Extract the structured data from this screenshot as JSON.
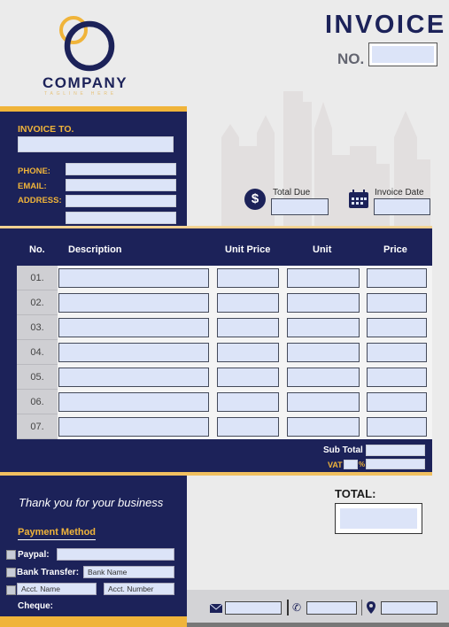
{
  "header": {
    "company_name": "COMPANY",
    "company_tagline": "TAGLINE HERE",
    "invoice_title": "INVOICE",
    "invoice_no_label": "NO.",
    "invoice_no_value": ""
  },
  "bill_to": {
    "title": "INVOICE TO.",
    "name_value": "",
    "fields": [
      {
        "label": "PHONE:",
        "value": ""
      },
      {
        "label": "EMAIL:",
        "value": ""
      },
      {
        "label": "ADDRESS:",
        "value": ""
      },
      {
        "label": "",
        "value": ""
      }
    ]
  },
  "summary": {
    "total_due_label": "Total Due",
    "total_due_value": "",
    "invoice_date_label": "Invoice Date",
    "invoice_date_value": "",
    "icons": {
      "total_due": "dollar-icon",
      "invoice_date": "calendar-icon"
    }
  },
  "table": {
    "columns": [
      "No.",
      "Description",
      "Unit Price",
      "Unit",
      "Price"
    ],
    "rows": [
      {
        "no": "01.",
        "description": "",
        "unit_price": "",
        "unit": "",
        "price": ""
      },
      {
        "no": "02.",
        "description": "",
        "unit_price": "",
        "unit": "",
        "price": ""
      },
      {
        "no": "03.",
        "description": "",
        "unit_price": "",
        "unit": "",
        "price": ""
      },
      {
        "no": "04.",
        "description": "",
        "unit_price": "",
        "unit": "",
        "price": ""
      },
      {
        "no": "05.",
        "description": "",
        "unit_price": "",
        "unit": "",
        "price": ""
      },
      {
        "no": "06.",
        "description": "",
        "unit_price": "",
        "unit": "",
        "price": ""
      },
      {
        "no": "07.",
        "description": "",
        "unit_price": "",
        "unit": "",
        "price": ""
      }
    ],
    "subtotal_label": "Sub Total",
    "subtotal_value": "",
    "vat_label": "VAT",
    "vat_rate": "",
    "vat_percent_sign": "%",
    "vat_value": ""
  },
  "footer": {
    "thanks": "Thank you for your business",
    "payment_method_title": "Payment Method",
    "paypal_label": "Paypal:",
    "bank_transfer_label": "Bank Transfer:",
    "bank_name_placeholder": "Bank Name",
    "acct_name_placeholder": "Acct. Name",
    "acct_number_placeholder": "Acct. Number",
    "cheque_label": "Cheque:",
    "total_label": "TOTAL:",
    "total_value": "",
    "contact_icons": [
      "email-icon",
      "phone-icon",
      "location-icon"
    ]
  },
  "colors": {
    "navy": "#1c2259",
    "gold": "#f0b43a",
    "field": "#dce4f8",
    "background": "#ebebeb"
  }
}
